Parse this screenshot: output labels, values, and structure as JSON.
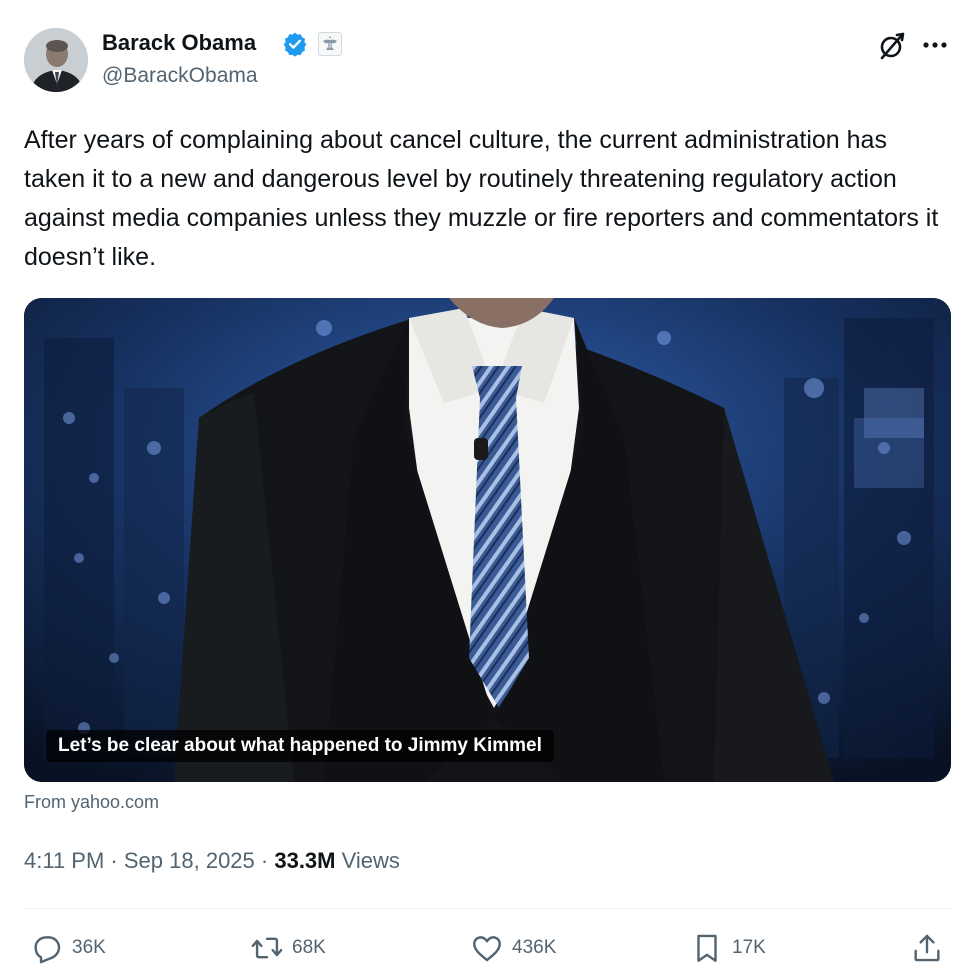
{
  "author": {
    "name": "Barack Obama",
    "handle": "@BarackObama"
  },
  "tweet": {
    "text": "After years of complaining about cancel culture, the current administration has taken it to a new and dangerous level by routinely threatening regulatory action against media companies unless they muzzle or fire reporters and commentators it doesn’t like."
  },
  "card": {
    "caption": "Let’s be clear about what happened to Jimmy Kimmel",
    "source": "From yahoo.com"
  },
  "meta": {
    "time": "4:11 PM",
    "sep1": " · ",
    "date": "Sep 18, 2025",
    "sep2": " · ",
    "views_count": "33.3M",
    "views_label": " Views"
  },
  "actions": {
    "replies": "36K",
    "reposts": "68K",
    "likes": "436K",
    "bookmarks": "17K"
  },
  "colors": {
    "verified": "#1d9bf0",
    "text_primary": "#0f1419",
    "text_secondary": "#536471"
  },
  "icons": [
    "verified-badge-icon",
    "government-affiliation-icon",
    "grok-icon",
    "more-icon",
    "reply-icon",
    "repost-icon",
    "like-icon",
    "bookmark-icon",
    "share-icon"
  ]
}
